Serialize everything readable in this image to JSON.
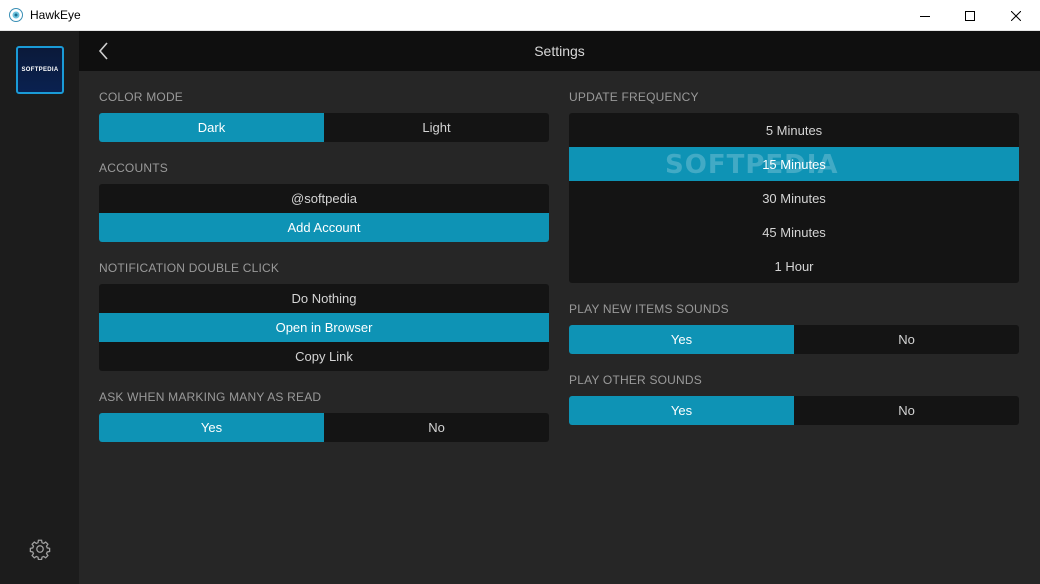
{
  "window": {
    "title": "HawkEye"
  },
  "rail": {
    "avatar_text": "SOFTPEDIA"
  },
  "header": {
    "title": "Settings"
  },
  "color_mode": {
    "label": "COLOR MODE",
    "options": [
      "Dark",
      "Light"
    ],
    "selected": "Dark"
  },
  "accounts": {
    "label": "ACCOUNTS",
    "items": [
      "@softpedia"
    ],
    "add_label": "Add Account"
  },
  "notification": {
    "label": "NOTIFICATION DOUBLE CLICK",
    "options": [
      "Do Nothing",
      "Open in Browser",
      "Copy Link"
    ],
    "selected": "Open in Browser"
  },
  "mark_read": {
    "label": "ASK WHEN MARKING MANY AS READ",
    "options": [
      "Yes",
      "No"
    ],
    "selected": "Yes"
  },
  "update_frequency": {
    "label": "UPDATE FREQUENCY",
    "options": [
      "5 Minutes",
      "15 Minutes",
      "30 Minutes",
      "45 Minutes",
      "1 Hour"
    ],
    "selected": "15 Minutes"
  },
  "new_items_sounds": {
    "label": "PLAY NEW ITEMS SOUNDS",
    "options": [
      "Yes",
      "No"
    ],
    "selected": "Yes"
  },
  "other_sounds": {
    "label": "PLAY OTHER SOUNDS",
    "options": [
      "Yes",
      "No"
    ],
    "selected": "Yes"
  },
  "watermark": "SOFTPEDIA",
  "colors": {
    "accent": "#0e93b5",
    "background": "#262626",
    "rail": "#1c1c1c",
    "header": "#0f0f0f",
    "control": "#141414"
  }
}
